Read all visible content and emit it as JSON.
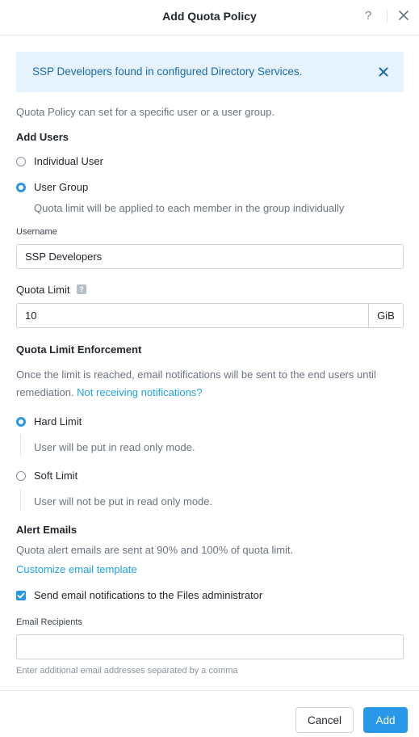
{
  "dialog": {
    "title": "Add Quota Policy",
    "help_glyph": "?",
    "help_icon": "question-mark-icon",
    "close_icon": "close-icon"
  },
  "alert": {
    "message": "SSP Developers found in configured Directory Services.",
    "close_icon": "close-icon",
    "color": "#1b6bb0",
    "background": "#e6f3fc"
  },
  "intro_text": "Quota Policy can set for a specific user or a user group.",
  "add_users": {
    "title": "Add Users",
    "options": [
      {
        "label": "Individual User",
        "selected": false
      },
      {
        "label": "User Group",
        "selected": true
      }
    ],
    "group_hint": "Quota limit will be applied to each member in the group individually"
  },
  "username": {
    "label": "Username",
    "value": "SSP Developers"
  },
  "quota_limit": {
    "label": "Quota Limit",
    "help_glyph": "?",
    "value": "10",
    "unit": "GiB"
  },
  "enforcement": {
    "title": "Quota Limit Enforcement",
    "description_line1": "Once the limit is reached, email notifications will be sent to the end users until",
    "description_line2": "remediation.",
    "link": "Not receiving notifications?",
    "options": [
      {
        "label": "Hard Limit",
        "hint": "User will be put in read only mode.",
        "selected": true
      },
      {
        "label": "Soft Limit",
        "hint": "User will not be put in read only mode.",
        "selected": false
      }
    ]
  },
  "alert_emails": {
    "title": "Alert Emails",
    "description": "Quota alert emails are sent at 90% and 100% of quota limit.",
    "customize_link": "Customize email template",
    "notify_admin": {
      "label": "Send email notifications to the Files administrator",
      "checked": true
    },
    "recipients_label": "Email Recipients",
    "recipients_value": "",
    "recipients_hint": "Enter additional email addresses separated by a comma"
  },
  "footer": {
    "cancel_label": "Cancel",
    "add_label": "Add"
  },
  "colors": {
    "accent": "#2a98e8",
    "link": "#1ea1e6",
    "text": "#22272e",
    "muted": "#6b7480"
  }
}
